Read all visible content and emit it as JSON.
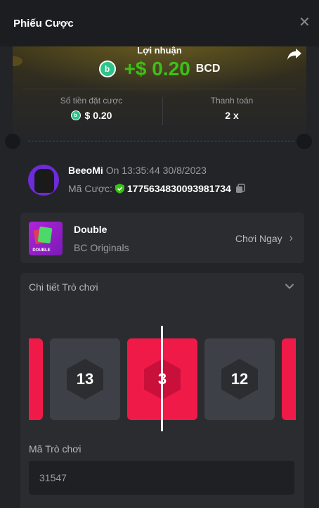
{
  "header": {
    "title": "Phiếu Cược",
    "close_icon": "close-icon"
  },
  "profit": {
    "label": "Lợi nhuận",
    "value": "+$ 0.20",
    "currency": "BCD",
    "coin_icon": "bc-coin-icon",
    "value_color": "#3bc117"
  },
  "stats": {
    "bet_amount_label": "Số tiền đặt cược",
    "bet_amount_value": "$ 0.20",
    "payout_label": "Thanh toán",
    "payout_value": "2 x"
  },
  "user": {
    "name": "BeeoMi",
    "time": "On 13:35:44 30/8/2023",
    "bet_id_label": "Mã Cược:",
    "bet_id_value": "1775634830093981734"
  },
  "game": {
    "name": "Double",
    "provider": "BC Originals",
    "thumb_label": "DOUBLE",
    "play_label": "Chơi Ngay"
  },
  "details": {
    "heading": "Chi tiết Trò chơi",
    "tiles": [
      {
        "number": "",
        "color": "red"
      },
      {
        "number": "13",
        "color": "grey"
      },
      {
        "number": "3",
        "color": "red"
      },
      {
        "number": "12",
        "color": "grey"
      },
      {
        "number": "",
        "color": "red"
      }
    ],
    "game_id_label": "Mã Trò chơi",
    "game_id_value": "31547"
  },
  "colors": {
    "red": "#f01a48",
    "grey": "#3d4046",
    "accent_green": "#3bc117"
  }
}
